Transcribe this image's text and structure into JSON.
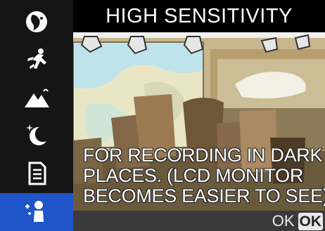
{
  "sidebar": {
    "items": [
      {
        "icon": "portrait-icon",
        "selected": false
      },
      {
        "icon": "sports-icon",
        "selected": false
      },
      {
        "icon": "landscape-icon",
        "selected": false
      },
      {
        "icon": "night-portrait-icon",
        "selected": false
      },
      {
        "icon": "document-icon",
        "selected": false
      },
      {
        "icon": "high-sensitivity-icon",
        "selected": true
      }
    ],
    "selected_color": "#1f55c8"
  },
  "header": {
    "title": "HIGH SENSITIVITY"
  },
  "description": {
    "lines": [
      "FOR RECORDING IN DARK",
      "PLACES. (LCD MONITOR",
      "BECOMES EASIER TO SEE)"
    ]
  },
  "footer": {
    "ok_label": "OK",
    "ok_key": "OK"
  }
}
